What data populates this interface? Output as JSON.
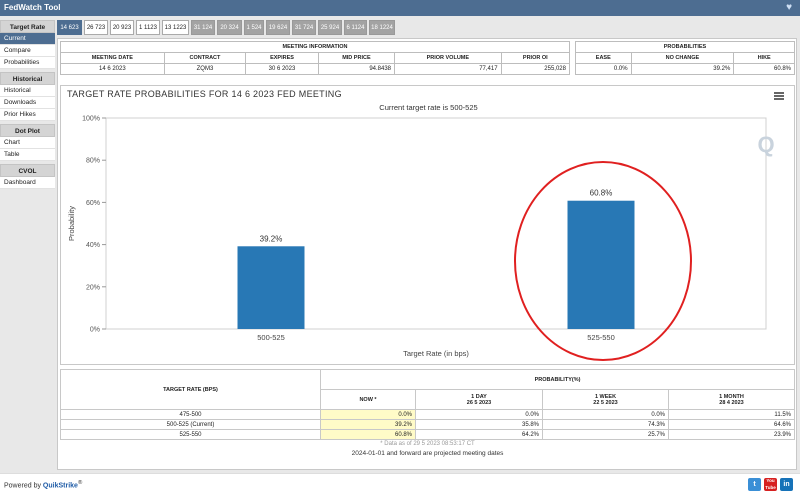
{
  "app": {
    "title": "FedWatch Tool"
  },
  "sidebar": {
    "sections": [
      {
        "header": "Target Rate",
        "items": [
          "Current",
          "Compare",
          "Probabilities"
        ]
      },
      {
        "header": "Historical",
        "items": [
          "Historical",
          "Downloads",
          "Prior Hikes"
        ]
      },
      {
        "header": "Dot Plot",
        "items": [
          "Chart",
          "Table"
        ]
      },
      {
        "header": "CVOL",
        "items": [
          "Dashboard"
        ]
      }
    ]
  },
  "tabs": [
    "14 623",
    "26 723",
    "20 923",
    "1 1123",
    "13 1223",
    "31 124",
    "20 324",
    "1 524",
    "19 624",
    "31 724",
    "25 924",
    "6 1124",
    "18 1224"
  ],
  "meeting_info": {
    "title": "MEETING INFORMATION",
    "headers": [
      "MEETING DATE",
      "CONTRACT",
      "EXPIRES",
      "MID PRICE",
      "PRIOR VOLUME",
      "PRIOR OI"
    ],
    "values": [
      "14 6 2023",
      "ZQM3",
      "30 6 2023",
      "94.8438",
      "77,417",
      "255,028"
    ]
  },
  "probabilities": {
    "title": "PROBABILITIES",
    "headers": [
      "EASE",
      "NO CHANGE",
      "HIKE"
    ],
    "values": [
      "0.0%",
      "39.2%",
      "60.8%"
    ]
  },
  "chart": {
    "title": "TARGET RATE PROBABILITIES FOR 14 6 2023 FED MEETING",
    "subtitle": "Current target rate is 500-525",
    "logo_letter": "Q"
  },
  "chart_data": {
    "type": "bar",
    "categories": [
      "500-525",
      "525-550"
    ],
    "values": [
      39.2,
      60.8
    ],
    "data_labels": [
      "39.2%",
      "60.8%"
    ],
    "title": "TARGET RATE PROBABILITIES FOR 14 6 2023 FED MEETING",
    "subtitle": "Current target rate is 500-525",
    "xlabel": "Target Rate (in bps)",
    "ylabel": "Probability",
    "ylim": [
      0,
      100
    ],
    "yticks": [
      "0%",
      "20%",
      "40%",
      "60%",
      "80%",
      "100%"
    ],
    "grid": false,
    "bar_color": "#2878b5",
    "highlight_circle_color": "#e02020",
    "highlighted_category": "525-550"
  },
  "prob_table": {
    "col_target": "TARGET RATE (BPS)",
    "col_prob": "PROBABILITY(%)",
    "sub_headers": [
      {
        "label": "NOW *",
        "date": ""
      },
      {
        "label": "1 DAY",
        "date": "26 5 2023"
      },
      {
        "label": "1 WEEK",
        "date": "22 5 2023"
      },
      {
        "label": "1 MONTH",
        "date": "28 4 2023"
      }
    ],
    "rows": [
      {
        "rate": "475-500",
        "now": "0.0%",
        "d1": "0.0%",
        "w1": "0.0%",
        "m1": "11.5%"
      },
      {
        "rate": "500-525 (Current)",
        "now": "39.2%",
        "d1": "35.8%",
        "w1": "74.3%",
        "m1": "64.6%"
      },
      {
        "rate": "525-550",
        "now": "60.8%",
        "d1": "64.2%",
        "w1": "25.7%",
        "m1": "23.9%"
      }
    ],
    "note": "* Data as of 29 5 2023 08:53:17 CT",
    "note2": "2024-01-01 and forward are projected meeting dates"
  },
  "footer": {
    "powered": "Powered by ",
    "brand": "QuikStrike",
    "reg": "®",
    "twitter_letter": "t",
    "youtube": "You Tube",
    "linkedin": "in"
  }
}
